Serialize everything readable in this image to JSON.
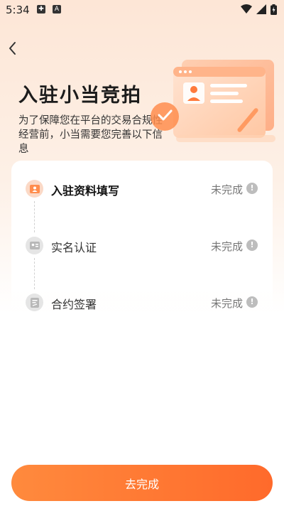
{
  "status_bar": {
    "time": "5:34",
    "badges": [
      "✚",
      "A"
    ],
    "icons": [
      "wifi-icon",
      "signal-icon",
      "battery-charging-icon"
    ]
  },
  "nav": {
    "back_icon": "chevron-left-icon"
  },
  "hero": {
    "title": "入驻小当竞拍",
    "description": "为了保障您在平台的交易合规性经营前，小当需要您完善以下信息"
  },
  "steps": [
    {
      "label": "入驻资料填写",
      "status": "未完成",
      "icon": "profile-card-icon",
      "active": true
    },
    {
      "label": "实名认证",
      "status": "未完成",
      "icon": "id-card-icon",
      "active": false
    },
    {
      "label": "合约签署",
      "status": "未完成",
      "icon": "document-sign-icon",
      "active": false
    }
  ],
  "info_glyph": "!",
  "cta": {
    "label": "去完成"
  },
  "colors": {
    "accent": "#ff7a35",
    "active_icon_bg": "#fbd9c6",
    "inactive_icon_bg": "#e5e5e5",
    "status_text": "#777777",
    "info_icon": "#bdbdbd"
  }
}
